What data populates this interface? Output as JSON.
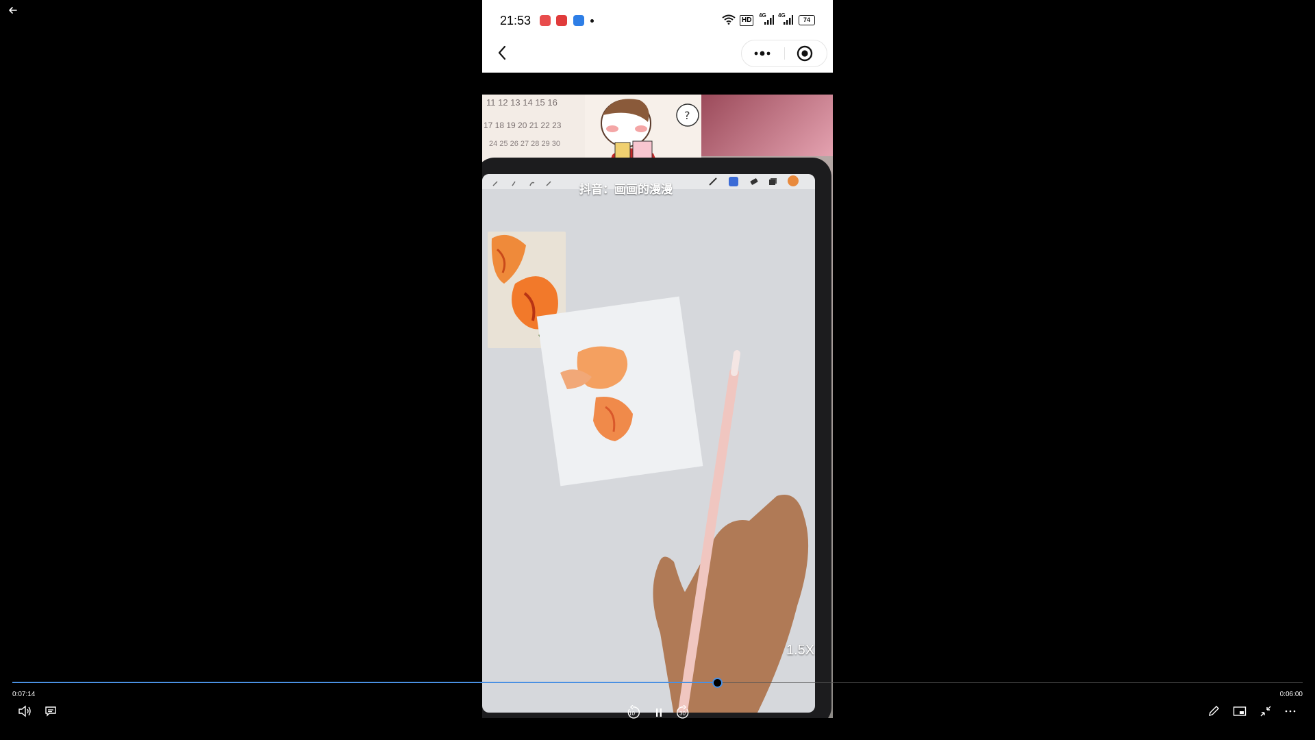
{
  "player": {
    "current_time": "0:07:14",
    "duration": "0:06:00",
    "progress": 0.546,
    "accent": "#4a90e2",
    "controls": {
      "back": "back-arrow-icon",
      "volume": "volume-icon",
      "captions": "captions-icon",
      "rewind_label": "10",
      "forward_label": "30",
      "pause": "pause-icon",
      "edit": "pencil-icon",
      "mini_player": "mini-player-icon",
      "exit_fullscreen": "exit-fullscreen-icon",
      "more": "more-icon"
    }
  },
  "phone": {
    "status_time": "21:53",
    "status_icons": [
      "music-app-icon",
      "video-app-icon",
      "news-app-icon",
      "dot-icon"
    ],
    "right_status": {
      "hd": "HD",
      "net1": "4G",
      "net2": "4G",
      "battery": "74"
    },
    "nav": {
      "back": "chevron-left-icon",
      "more": "more-dots-icon",
      "record": "record-icon"
    }
  },
  "video": {
    "watermark": "抖音：画画的漫漫",
    "speed_label": "1.5X",
    "calendar_rows": [
      "11 12 13 14 15 16",
      "17 18 19 20 21 22 23",
      "24 25 26 27 28 29 30"
    ]
  }
}
